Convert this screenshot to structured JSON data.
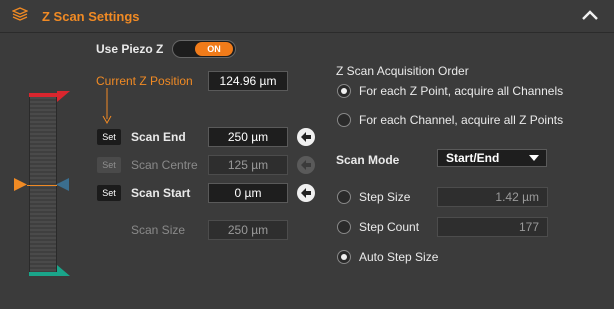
{
  "header": {
    "title": "Z Scan Settings",
    "icon": "layers-stack-icon",
    "collapse_icon": "chevron-up-icon",
    "accent_color": "#f08a24"
  },
  "piezo": {
    "label": "Use Piezo Z",
    "toggle_text": "ON",
    "toggle_color": "#f07b1a"
  },
  "current_z": {
    "label": "Current Z Position",
    "value": "124.96 µm"
  },
  "scan_end": {
    "set_label": "Set",
    "label": "Scan End",
    "value": "250 µm"
  },
  "scan_centre": {
    "set_label": "Set",
    "label": "Scan Centre",
    "value": "125 µm"
  },
  "scan_start": {
    "set_label": "Set",
    "label": "Scan Start",
    "value": "0 µm"
  },
  "scan_size": {
    "label": "Scan Size",
    "value": "250 µm"
  },
  "acquisition": {
    "heading": "Z Scan Acquisition Order",
    "option1": "For each Z Point, acquire all Channels",
    "option2": "For each Channel, acquire all Z Points",
    "selected": "option1"
  },
  "scan_mode": {
    "label": "Scan Mode",
    "selected": "Start/End"
  },
  "step": {
    "size_label": "Step Size",
    "size_value": "1.42 µm",
    "count_label": "Step Count",
    "count_value": "177",
    "auto_label": "Auto Step Size",
    "selected": "auto"
  },
  "colors": {
    "end_marker": "#d9262e",
    "start_marker": "#1aa58a",
    "current_marker": "#f08a24",
    "centre_marker": "#3b6e8f"
  }
}
